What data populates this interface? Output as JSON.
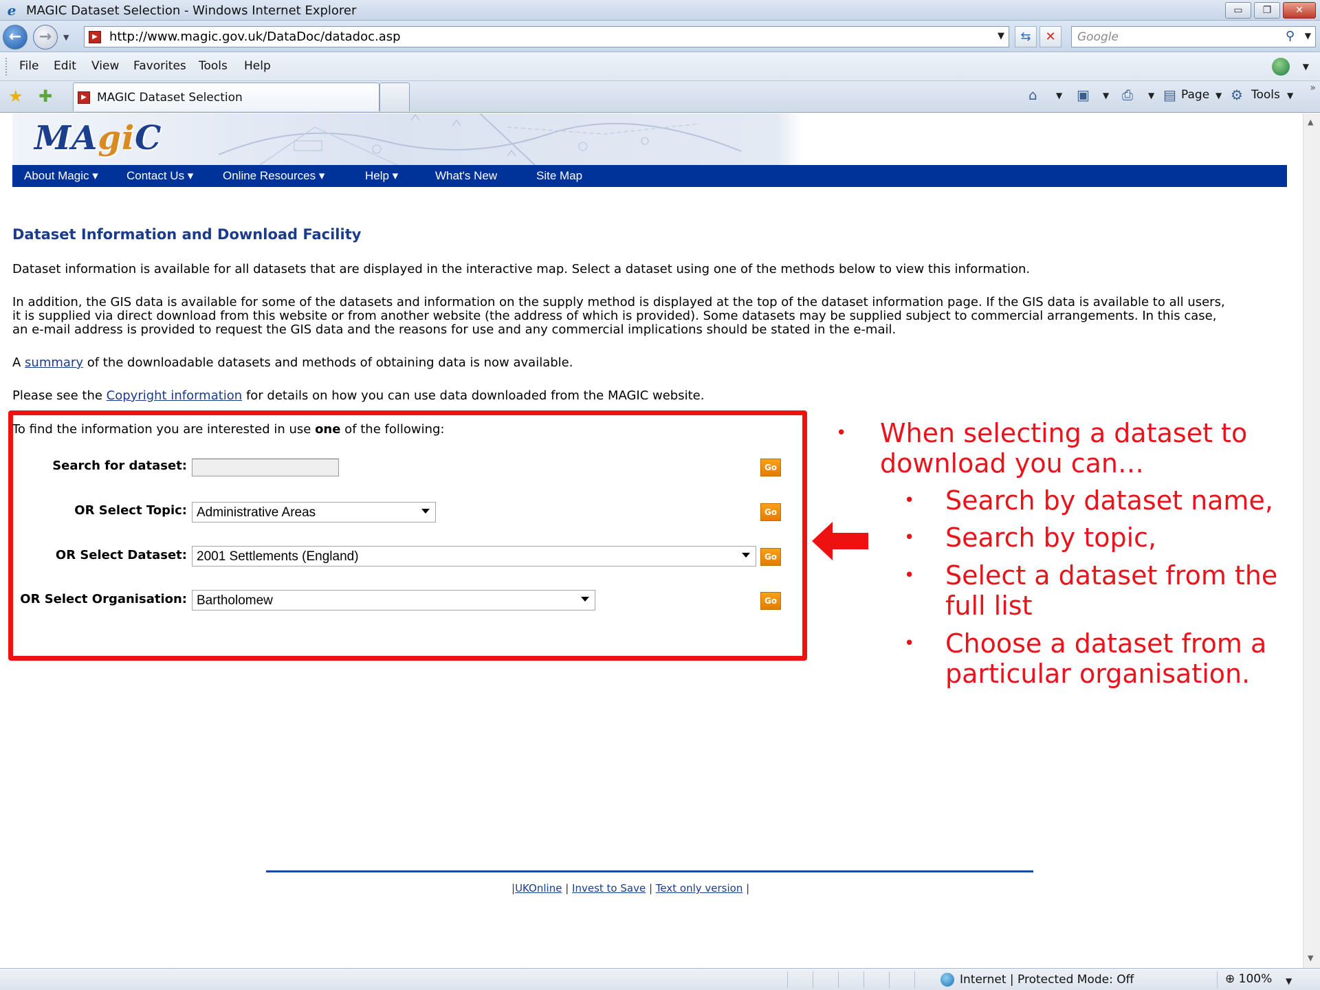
{
  "window": {
    "title": "MAGIC Dataset Selection - Windows Internet Explorer",
    "minimize": "▭",
    "restore": "❐",
    "close": "✕"
  },
  "address": {
    "url": "http://www.magic.gov.uk/DataDoc/datadoc.asp",
    "search_placeholder": "Google"
  },
  "menu": [
    "File",
    "Edit",
    "View",
    "Favorites",
    "Tools",
    "Help"
  ],
  "tab": {
    "label": "MAGIC Dataset Selection"
  },
  "commandbar": {
    "page": "Page",
    "tools": "Tools"
  },
  "site": {
    "logo_pre": "MA",
    "logo_mid": "gi",
    "logo_post": "C",
    "nav": [
      "About Magic ▾",
      "Contact Us ▾",
      "Online Resources ▾",
      "Help ▾",
      "What's New",
      "Site Map"
    ]
  },
  "content": {
    "title": "Dataset Information and Download Facility",
    "p1": "Dataset information is available for all datasets that are displayed in the interactive map. Select a dataset using one of the methods below to view this information.",
    "p2_l1": "In addition, the GIS data is available for some of the datasets and information on the supply method is displayed at the top of the dataset information page. If the GIS data is available to all users,",
    "p2_l2": "it is supplied via direct download from this website or from another website (the address of which is provided). Some datasets may be supplied subject to commercial arrangements. In this case,",
    "p2_l3": "an e-mail address is provided to request the GIS data and the reasons for use and any commercial implications should be stated in the e-mail.",
    "p3_pre": "A ",
    "p3_link": "summary",
    "p3_post": " of the downloadable datasets and methods of obtaining data is now available.",
    "p4_pre": "Please see the ",
    "p4_link": "Copyright information",
    "p4_post": " for details on how you can use data downloaded from the MAGIC website.",
    "intro_pre": "To find the information you are interested in use ",
    "intro_bold": "one",
    "intro_post": " of the following:"
  },
  "form": {
    "search_label": "Search for dataset:",
    "search_value": "",
    "topic_label": "OR Select Topic:",
    "topic_value": "Administrative Areas",
    "dataset_label": "OR Select Dataset:",
    "dataset_value": "2001 Settlements (England)",
    "org_label": "OR Select Organisation:",
    "org_value": "Bartholomew",
    "go": "Go"
  },
  "annotation": {
    "bullet": "•",
    "lead_l1": "When selecting a dataset to",
    "lead_l2": "download you can…",
    "b1": "Search by dataset name,",
    "b2": "Search by topic,",
    "b3_l1": "Select a dataset from the",
    "b3_l2": "full list",
    "b4_l1": "Choose a dataset from a",
    "b4_l2": "particular organisation."
  },
  "footer": {
    "sep_open": "|",
    "link1": "UKOnline",
    "sep": " | ",
    "link2": "Invest to Save",
    "link3": "Text only version",
    "sep_close": " |"
  },
  "status": {
    "zone": "Internet | Protected Mode: Off",
    "zoom": "100%"
  },
  "colors": {
    "nav_bg": "#003399",
    "heading": "#1a3c8b",
    "highlight_red": "#ee1111",
    "go_orange": "#f39200"
  }
}
